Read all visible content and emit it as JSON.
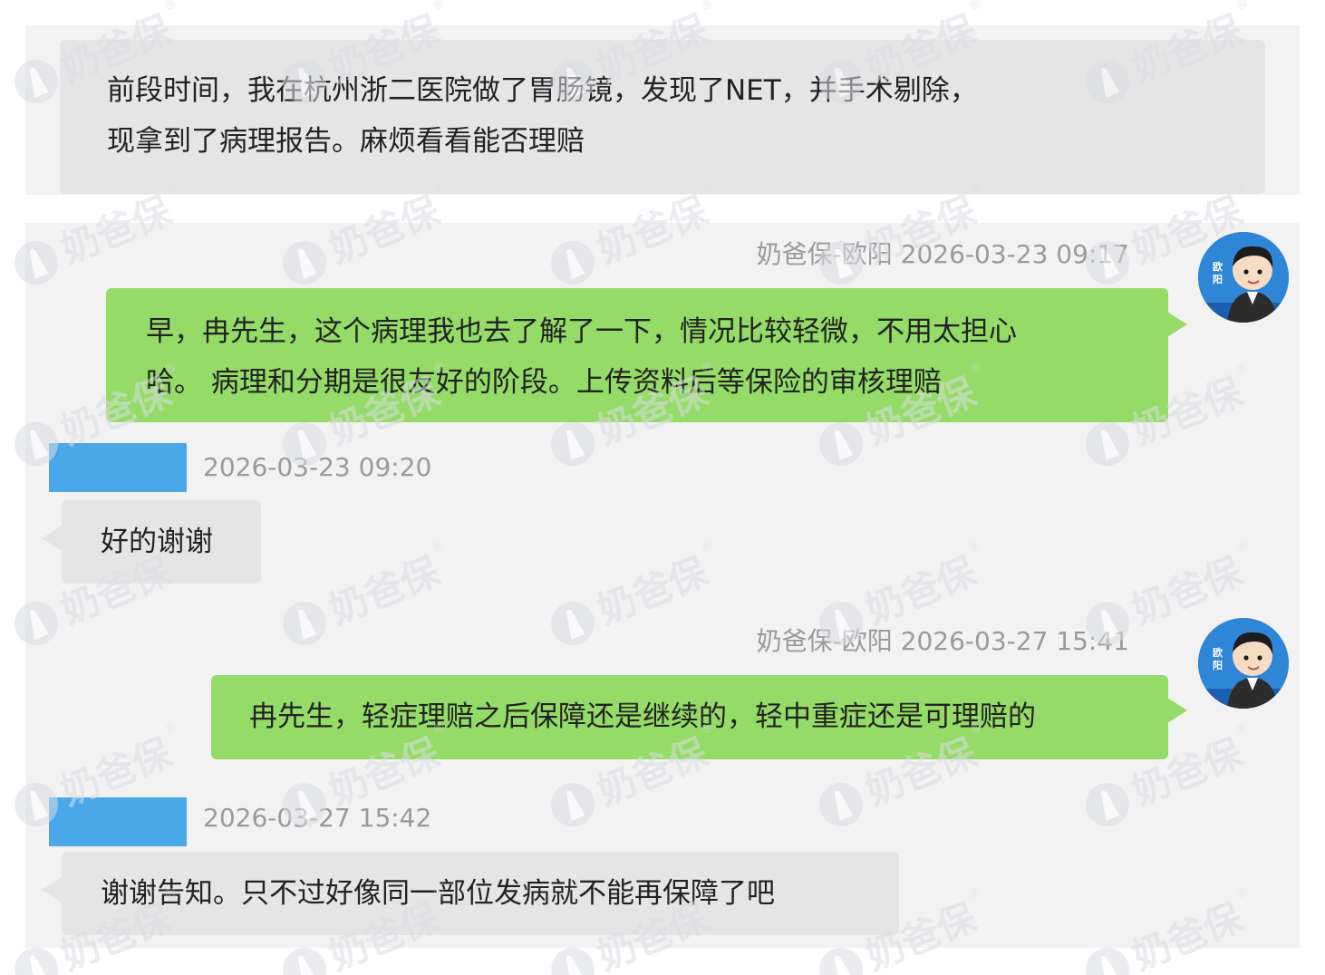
{
  "watermark": {
    "text": "奶爸保",
    "mark": "®"
  },
  "messages": [
    {
      "id": "customer-question",
      "side": "left",
      "lines": [
        "前段时间，我在杭州浙二医院做了胃肠镜，发现了NET，并手术剔除，",
        "现拿到了病理报告。麻烦看看能否理赔"
      ]
    },
    {
      "id": "agent-reply-1",
      "side": "right",
      "sender": "奶爸保-欧阳",
      "time": "2026-03-23 09:17",
      "avatar_label": "欧阳",
      "lines": [
        "早，冉先生，这个病理我也去了解了一下，情况比较轻微，不用太担心",
        "哈。 病理和分期是很友好的阶段。上传资料后等保险的审核理赔"
      ]
    },
    {
      "id": "customer-reply-1",
      "side": "left",
      "time": "2026-03-23 09:20",
      "sender_redacted": true,
      "lines": [
        "好的谢谢"
      ]
    },
    {
      "id": "agent-reply-2",
      "side": "right",
      "sender": "奶爸保-欧阳",
      "time": "2026-03-27 15:41",
      "avatar_label": "欧阳",
      "lines": [
        "冉先生，轻症理赔之后保障还是继续的，轻中重症还是可理赔的"
      ]
    },
    {
      "id": "customer-reply-2",
      "side": "left",
      "time": "2026-03-27 15:42",
      "sender_redacted": true,
      "lines": [
        "谢谢告知。只不过好像同一部位发病就不能再保障了吧"
      ]
    }
  ],
  "colors": {
    "panel_bg": "#f2f2f2",
    "bubble_gray": "#e5e5e5",
    "bubble_green": "#95db67",
    "meta_text": "#9a9a9a",
    "redaction": "#4aa8e8",
    "watermark": "#d9dde3"
  }
}
